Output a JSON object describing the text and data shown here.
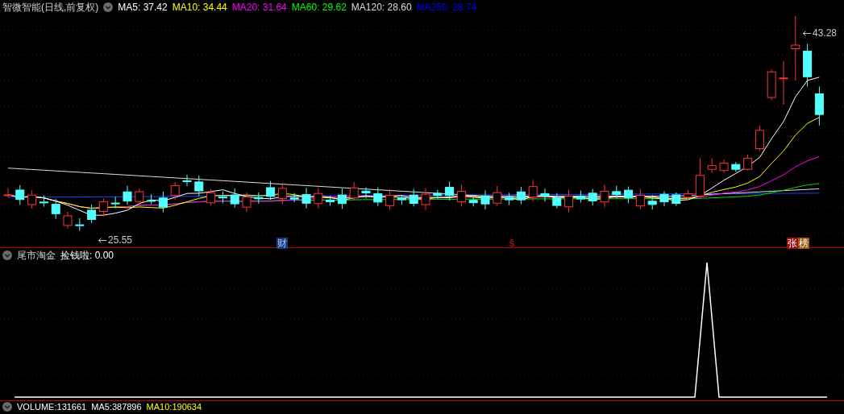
{
  "header": {
    "title": "智微智能(日线,前复权)",
    "indicators": [
      {
        "label": "MA5: 37.42",
        "color": "#ffffff"
      },
      {
        "label": "MA10: 34.44",
        "color": "#ffff00"
      },
      {
        "label": "MA20: 31.64",
        "color": "#ff00ff"
      },
      {
        "label": "MA60: 29.62",
        "color": "#00ff00"
      },
      {
        "label": "MA120: 28.60",
        "color": "#dddddd"
      },
      {
        "label": "MA250: 28.74",
        "color": "#0000ff"
      }
    ]
  },
  "price_labels": [
    {
      "kind": "high",
      "text": "43.28"
    },
    {
      "kind": "low",
      "text": "25.55"
    }
  ],
  "markers": [
    {
      "kind": "finance",
      "text": "财"
    },
    {
      "kind": "signal",
      "text": "ŝ"
    },
    {
      "kind": "rise",
      "text": "张"
    },
    {
      "kind": "list",
      "text": "榜"
    }
  ],
  "sub_panel": {
    "title": "尾市淘金",
    "indicator": "捡钱啦: 0.00"
  },
  "volume_panel": {
    "indicators": [
      {
        "label": "VOLUME:131661",
        "color": "#ffffff"
      },
      {
        "label": "MA5:387896",
        "color": "#ffffff"
      },
      {
        "label": "MA10:190634",
        "color": "#ffff00"
      }
    ]
  }
}
